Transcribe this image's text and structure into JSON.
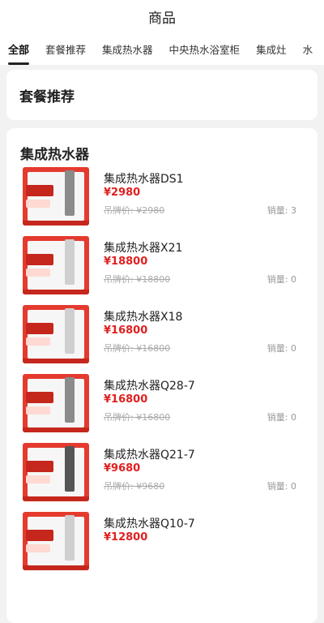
{
  "header": {
    "title": "商品"
  },
  "tabs": [
    {
      "label": "全部",
      "active": true
    },
    {
      "label": "套餐推荐",
      "active": false
    },
    {
      "label": "集成热水器",
      "active": false
    },
    {
      "label": "中央热水浴室柜",
      "active": false
    },
    {
      "label": "集成灶",
      "active": false
    },
    {
      "label": "水",
      "active": false
    }
  ],
  "packages": {
    "title": "套餐推荐"
  },
  "section": {
    "title": "集成热水器"
  },
  "products": [
    {
      "name": "集成热水器DS1",
      "price": "¥2980",
      "original": "吊牌价: ¥2980",
      "sales": "销量: 3"
    },
    {
      "name": "集成热水器X21",
      "price": "¥18800",
      "original": "吊牌价: ¥18800",
      "sales": "销量: 0"
    },
    {
      "name": "集成热水器X18",
      "price": "¥16800",
      "original": "吊牌价: ¥16800",
      "sales": "销量: 0"
    },
    {
      "name": "集成热水器Q28-7",
      "price": "¥16800",
      "original": "吊牌价: ¥16800",
      "sales": "销量: 0"
    },
    {
      "name": "集成热水器Q21-7",
      "price": "¥9680",
      "original": "吊牌价: ¥9680",
      "sales": "销量: 0"
    },
    {
      "name": "集成热水器Q10-7",
      "price": "¥12800",
      "original": "",
      "sales": ""
    }
  ],
  "colors": {
    "price": "#e02020",
    "brand_red": "#e53a2e",
    "background": "#f2f2f2"
  }
}
